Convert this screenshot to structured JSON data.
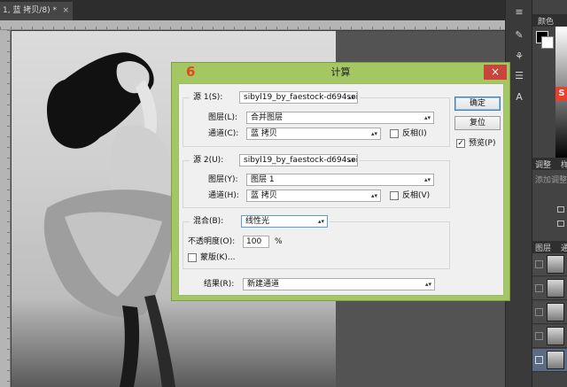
{
  "app": {
    "doc_tab": "1, 蓝 拷贝/8) *",
    "doc_tab_close": "×"
  },
  "right_panel": {
    "color_tab": "颜色",
    "adjust_tab": "调整",
    "adjust_tab_more": "样",
    "adjust_hint": "添加调整",
    "layers_tab": "图层",
    "layers_tab_more": "通",
    "brand_glyph": "S"
  },
  "dialog": {
    "step_number": "6",
    "title": "计算",
    "close_glyph": "×",
    "source1": {
      "label": "源 1(S):",
      "value": "sibyl19_by_faestock-d694soi.j...",
      "layer_label": "图层(L):",
      "layer_value": "合并图层",
      "channel_label": "通道(C):",
      "channel_value": "蓝 拷贝",
      "invert_label": "反相(I)"
    },
    "source2": {
      "label": "源 2(U):",
      "value": "sibyl19_by_faestock-d694soi.j...",
      "layer_label": "图层(Y):",
      "layer_value": "图层 1",
      "channel_label": "通道(H):",
      "channel_value": "蓝 拷贝",
      "invert_label": "反相(V)"
    },
    "blend": {
      "label": "混合(B):",
      "value": "线性光",
      "opacity_label": "不透明度(O):",
      "opacity_value": "100",
      "opacity_unit": "%",
      "mask_label": "蒙版(K)..."
    },
    "result": {
      "label": "结果(R):",
      "value": "新建通道"
    },
    "buttons": {
      "ok": "确定",
      "reset": "复位",
      "preview": "预览(P)",
      "preview_checked": "✓"
    }
  },
  "colors": {
    "dialog_border": "#a4c663",
    "close_button": "#c9443a",
    "step_number": "#e24a1b"
  }
}
